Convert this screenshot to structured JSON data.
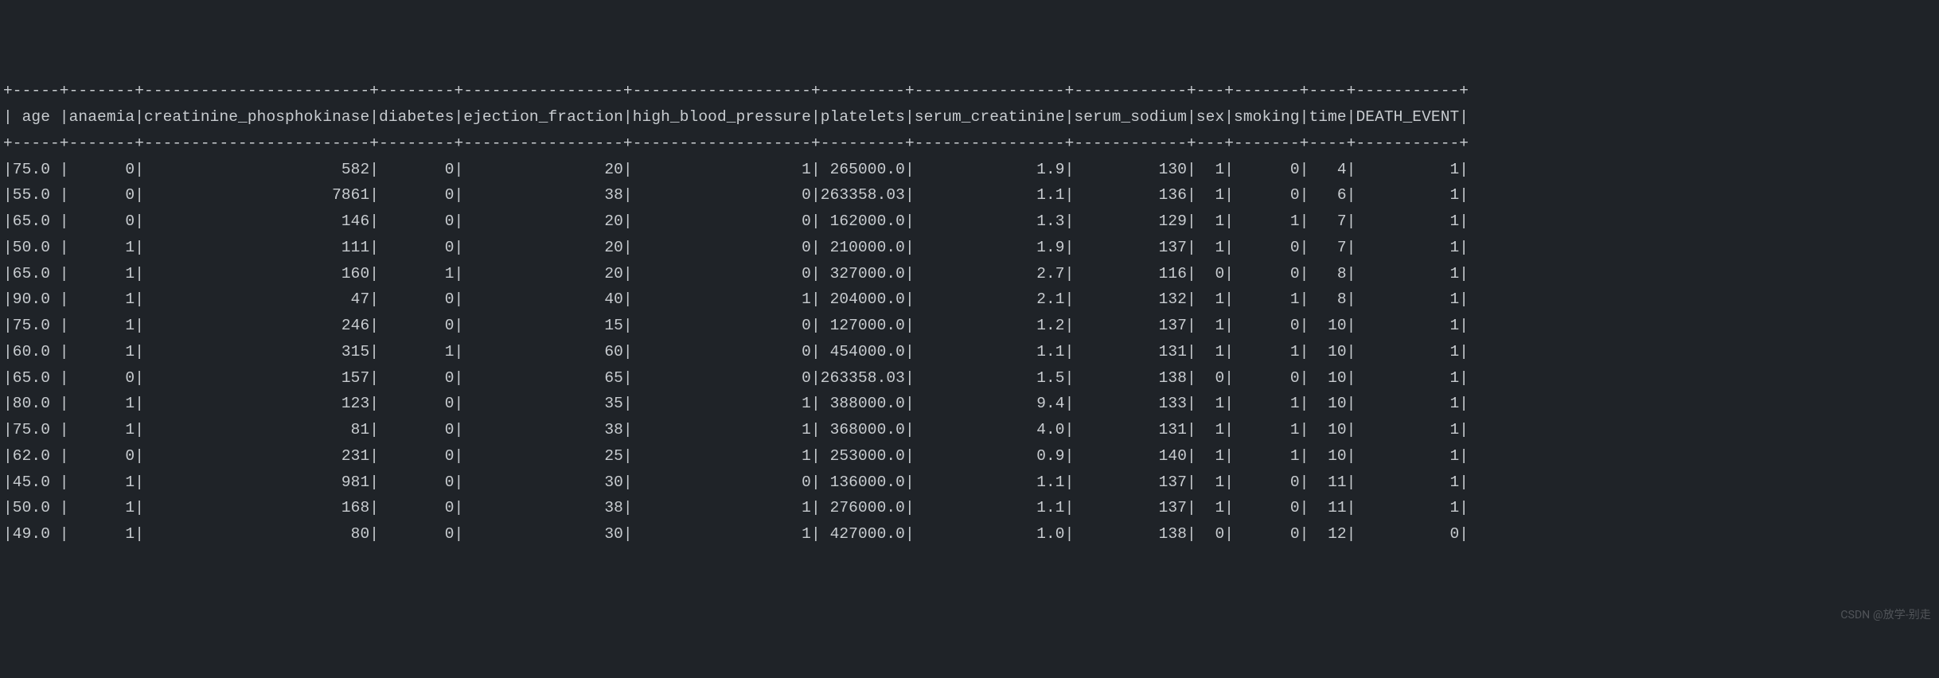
{
  "watermark": "CSDN @放学-别走",
  "table": {
    "columns": [
      {
        "name": " age",
        "width": 5,
        "align": "left"
      },
      {
        "name": "anaemia",
        "width": 7,
        "align": "right"
      },
      {
        "name": "creatinine_phosphokinase",
        "width": 24,
        "align": "right"
      },
      {
        "name": "diabetes",
        "width": 8,
        "align": "right"
      },
      {
        "name": "ejection_fraction",
        "width": 17,
        "align": "right"
      },
      {
        "name": "high_blood_pressure",
        "width": 19,
        "align": "right"
      },
      {
        "name": "platelets",
        "width": 9,
        "align": "right"
      },
      {
        "name": "serum_creatinine",
        "width": 16,
        "align": "right"
      },
      {
        "name": "serum_sodium",
        "width": 12,
        "align": "right"
      },
      {
        "name": "sex",
        "width": 3,
        "align": "right"
      },
      {
        "name": "smoking",
        "width": 7,
        "align": "right"
      },
      {
        "name": "time",
        "width": 4,
        "align": "right"
      },
      {
        "name": "DEATH_EVENT",
        "width": 11,
        "align": "right"
      }
    ],
    "rows": [
      [
        "75.0",
        "0",
        "582",
        "0",
        "20",
        "1",
        " 265000.0",
        "1.9",
        "130",
        "1",
        "0",
        "4",
        "1"
      ],
      [
        "55.0",
        "0",
        "7861",
        "0",
        "38",
        "0",
        "263358.03",
        "1.1",
        "136",
        "1",
        "0",
        "6",
        "1"
      ],
      [
        "65.0",
        "0",
        "146",
        "0",
        "20",
        "0",
        " 162000.0",
        "1.3",
        "129",
        "1",
        "1",
        "7",
        "1"
      ],
      [
        "50.0",
        "1",
        "111",
        "0",
        "20",
        "0",
        " 210000.0",
        "1.9",
        "137",
        "1",
        "0",
        "7",
        "1"
      ],
      [
        "65.0",
        "1",
        "160",
        "1",
        "20",
        "0",
        " 327000.0",
        "2.7",
        "116",
        "0",
        "0",
        "8",
        "1"
      ],
      [
        "90.0",
        "1",
        "47",
        "0",
        "40",
        "1",
        " 204000.0",
        "2.1",
        "132",
        "1",
        "1",
        "8",
        "1"
      ],
      [
        "75.0",
        "1",
        "246",
        "0",
        "15",
        "0",
        " 127000.0",
        "1.2",
        "137",
        "1",
        "0",
        "10",
        "1"
      ],
      [
        "60.0",
        "1",
        "315",
        "1",
        "60",
        "0",
        " 454000.0",
        "1.1",
        "131",
        "1",
        "1",
        "10",
        "1"
      ],
      [
        "65.0",
        "0",
        "157",
        "0",
        "65",
        "0",
        "263358.03",
        "1.5",
        "138",
        "0",
        "0",
        "10",
        "1"
      ],
      [
        "80.0",
        "1",
        "123",
        "0",
        "35",
        "1",
        " 388000.0",
        "9.4",
        "133",
        "1",
        "1",
        "10",
        "1"
      ],
      [
        "75.0",
        "1",
        "81",
        "0",
        "38",
        "1",
        " 368000.0",
        "4.0",
        "131",
        "1",
        "1",
        "10",
        "1"
      ],
      [
        "62.0",
        "0",
        "231",
        "0",
        "25",
        "1",
        " 253000.0",
        "0.9",
        "140",
        "1",
        "1",
        "10",
        "1"
      ],
      [
        "45.0",
        "1",
        "981",
        "0",
        "30",
        "0",
        " 136000.0",
        "1.1",
        "137",
        "1",
        "0",
        "11",
        "1"
      ],
      [
        "50.0",
        "1",
        "168",
        "0",
        "38",
        "1",
        " 276000.0",
        "1.1",
        "137",
        "1",
        "0",
        "11",
        "1"
      ],
      [
        "49.0",
        "1",
        "80",
        "0",
        "30",
        "1",
        " 427000.0",
        "1.0",
        "138",
        "0",
        "0",
        "12",
        "0"
      ]
    ]
  }
}
